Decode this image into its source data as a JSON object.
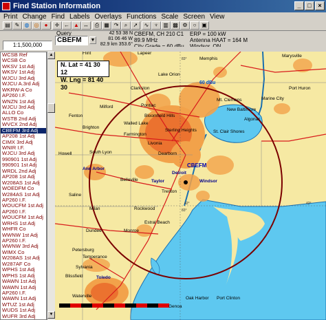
{
  "window": {
    "title": "Find Station Information",
    "controls": [
      "_",
      "□",
      "×"
    ]
  },
  "menu": [
    "Print",
    "Change",
    "Find",
    "Labels",
    "Overlays",
    "Functions",
    "Scale",
    "Screen",
    "View"
  ],
  "toolbar": {
    "icons": [
      "clipboard-icon",
      "paint-icon",
      "globe-icon",
      "target-icon",
      "red-circle-icon",
      "arrow-left-icon",
      "car-icon",
      "cross-icon",
      "print-icon",
      "arrows-icon",
      "table-icon",
      "spiral-icon",
      "magnify-icon",
      "pointer-icon",
      "wave-icon",
      "antenna-icon",
      "chart-icon",
      "grid-icon",
      "settings-icon",
      "circle-icon",
      "save-icon"
    ]
  },
  "info": {
    "scale": "1:1,500,000",
    "query_label": "Query",
    "query_value": "CBEFM",
    "lat": "42 53 38 N",
    "lng": "81 06 46 W",
    "dist": "82.9 km",
    "bearing": "353.6°",
    "call_line": "CBEFM, CH 210 C1",
    "freq": "89.9 MHz",
    "city_grade": "City Grade = 60 dBu",
    "erp": "ERP = 100 kW",
    "haat": "Antenna HAAT = 164 M",
    "city": "Windsor, ON"
  },
  "stations": [
    "WCSB  Ref",
    "WCSB  Co",
    "WKSV  1st Adj",
    "WKSV  1st Adj",
    "WJCU  3rd Adj",
    "WJCU  A.3rd Adj",
    "WKRW-A Co",
    "AP260 I.F.",
    "WNZN  1st Adj",
    "WJCU  3rd Adj",
    "ALLO  Co",
    "WSTB  2nd Adj",
    "WVCX  2nd Adj",
    "CBEFM 3rd Adj",
    "AP208  1st Adj",
    "CIMX  3rd Adj",
    "WNIR  I.F.",
    "WJCU  3rd Adj",
    "990901 1st Adj",
    "990901 1st Adj",
    "WRDL  2nd Adj",
    "AP208 1st Adj",
    "W208AS 1st Adj",
    "WOEDFM Co",
    "W284AS 1st Adj",
    "AP260  I.F.",
    "WOUCFM 1st Adj",
    "AP260  I.F.",
    "WOUCFM 1st Adj",
    "WRHS  1st Adj",
    "WHFR  Co",
    "WWNW  1st Adj",
    "AP260 I.F.",
    "WWNW  3rd Adj",
    "WIMX  Co",
    "W208AS 1st Adj",
    "W287AF Co",
    "WPHS  1st Adj",
    "WPHS  1st Adj",
    "WAWN  1st Adj",
    "WAWN  1st Adj",
    "AP260  I.F.",
    "WAWN  1st Adj",
    "WTUZ  1st Adj",
    "WUDS  1st Adj",
    "WUFR  3rd Adj"
  ],
  "selected_index": 13,
  "map": {
    "latlng_box": {
      "lat": "N. Lat = 41 30 12",
      "lng": "W. Lng = 81 40 30"
    },
    "labels": [
      "Flint",
      "Lapeer",
      "Memphis",
      "Marysville",
      "Lake Orion",
      "Port Huron",
      "Clarkston",
      "Marine City",
      "Milford",
      "Pontiac",
      "Bloomfield Hills",
      "Mt. Clemens",
      "New Baltimore",
      "Algonac",
      "Fenton",
      "Brighton",
      "Walled Lake",
      "Farmington",
      "Sterling Heights",
      "St. Clair Shores",
      "Howell",
      "South Lyon",
      "Livonia",
      "Dearborn",
      "Detroit",
      "Ann Arbor",
      "Belleville",
      "Taylor",
      "Trenton",
      "Saline",
      "Milan",
      "Rockwood",
      "Dundee",
      "Monroe",
      "Estral Beach",
      "Petersburg",
      "Temperance",
      "Blissfield",
      "Sylvania",
      "Toledo",
      "Waterville",
      "Oak Harbor",
      "Port Clinton",
      "Genoa",
      "Windsor",
      "CBEFM"
    ],
    "dbu_label": "60 dBu",
    "lat_ticks": [
      "42°",
      "42°"
    ],
    "lng_ticks": [
      "83°",
      "83°"
    ]
  }
}
